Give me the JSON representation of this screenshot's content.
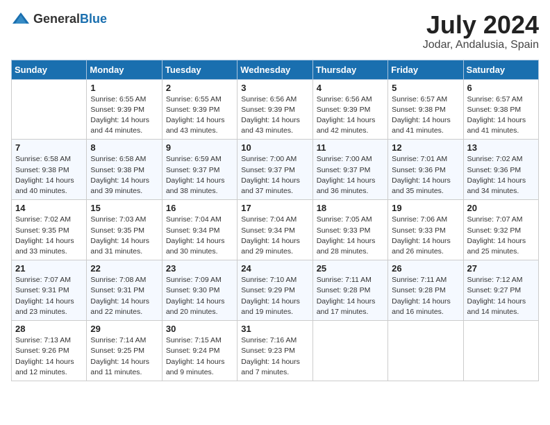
{
  "header": {
    "logo_general": "General",
    "logo_blue": "Blue",
    "month_year": "July 2024",
    "location": "Jodar, Andalusia, Spain"
  },
  "days_of_week": [
    "Sunday",
    "Monday",
    "Tuesday",
    "Wednesday",
    "Thursday",
    "Friday",
    "Saturday"
  ],
  "weeks": [
    [
      {
        "day": "",
        "info": ""
      },
      {
        "day": "1",
        "info": "Sunrise: 6:55 AM\nSunset: 9:39 PM\nDaylight: 14 hours\nand 44 minutes."
      },
      {
        "day": "2",
        "info": "Sunrise: 6:55 AM\nSunset: 9:39 PM\nDaylight: 14 hours\nand 43 minutes."
      },
      {
        "day": "3",
        "info": "Sunrise: 6:56 AM\nSunset: 9:39 PM\nDaylight: 14 hours\nand 43 minutes."
      },
      {
        "day": "4",
        "info": "Sunrise: 6:56 AM\nSunset: 9:39 PM\nDaylight: 14 hours\nand 42 minutes."
      },
      {
        "day": "5",
        "info": "Sunrise: 6:57 AM\nSunset: 9:38 PM\nDaylight: 14 hours\nand 41 minutes."
      },
      {
        "day": "6",
        "info": "Sunrise: 6:57 AM\nSunset: 9:38 PM\nDaylight: 14 hours\nand 41 minutes."
      }
    ],
    [
      {
        "day": "7",
        "info": "Sunrise: 6:58 AM\nSunset: 9:38 PM\nDaylight: 14 hours\nand 40 minutes."
      },
      {
        "day": "8",
        "info": "Sunrise: 6:58 AM\nSunset: 9:38 PM\nDaylight: 14 hours\nand 39 minutes."
      },
      {
        "day": "9",
        "info": "Sunrise: 6:59 AM\nSunset: 9:37 PM\nDaylight: 14 hours\nand 38 minutes."
      },
      {
        "day": "10",
        "info": "Sunrise: 7:00 AM\nSunset: 9:37 PM\nDaylight: 14 hours\nand 37 minutes."
      },
      {
        "day": "11",
        "info": "Sunrise: 7:00 AM\nSunset: 9:37 PM\nDaylight: 14 hours\nand 36 minutes."
      },
      {
        "day": "12",
        "info": "Sunrise: 7:01 AM\nSunset: 9:36 PM\nDaylight: 14 hours\nand 35 minutes."
      },
      {
        "day": "13",
        "info": "Sunrise: 7:02 AM\nSunset: 9:36 PM\nDaylight: 14 hours\nand 34 minutes."
      }
    ],
    [
      {
        "day": "14",
        "info": "Sunrise: 7:02 AM\nSunset: 9:35 PM\nDaylight: 14 hours\nand 33 minutes."
      },
      {
        "day": "15",
        "info": "Sunrise: 7:03 AM\nSunset: 9:35 PM\nDaylight: 14 hours\nand 31 minutes."
      },
      {
        "day": "16",
        "info": "Sunrise: 7:04 AM\nSunset: 9:34 PM\nDaylight: 14 hours\nand 30 minutes."
      },
      {
        "day": "17",
        "info": "Sunrise: 7:04 AM\nSunset: 9:34 PM\nDaylight: 14 hours\nand 29 minutes."
      },
      {
        "day": "18",
        "info": "Sunrise: 7:05 AM\nSunset: 9:33 PM\nDaylight: 14 hours\nand 28 minutes."
      },
      {
        "day": "19",
        "info": "Sunrise: 7:06 AM\nSunset: 9:33 PM\nDaylight: 14 hours\nand 26 minutes."
      },
      {
        "day": "20",
        "info": "Sunrise: 7:07 AM\nSunset: 9:32 PM\nDaylight: 14 hours\nand 25 minutes."
      }
    ],
    [
      {
        "day": "21",
        "info": "Sunrise: 7:07 AM\nSunset: 9:31 PM\nDaylight: 14 hours\nand 23 minutes."
      },
      {
        "day": "22",
        "info": "Sunrise: 7:08 AM\nSunset: 9:31 PM\nDaylight: 14 hours\nand 22 minutes."
      },
      {
        "day": "23",
        "info": "Sunrise: 7:09 AM\nSunset: 9:30 PM\nDaylight: 14 hours\nand 20 minutes."
      },
      {
        "day": "24",
        "info": "Sunrise: 7:10 AM\nSunset: 9:29 PM\nDaylight: 14 hours\nand 19 minutes."
      },
      {
        "day": "25",
        "info": "Sunrise: 7:11 AM\nSunset: 9:28 PM\nDaylight: 14 hours\nand 17 minutes."
      },
      {
        "day": "26",
        "info": "Sunrise: 7:11 AM\nSunset: 9:28 PM\nDaylight: 14 hours\nand 16 minutes."
      },
      {
        "day": "27",
        "info": "Sunrise: 7:12 AM\nSunset: 9:27 PM\nDaylight: 14 hours\nand 14 minutes."
      }
    ],
    [
      {
        "day": "28",
        "info": "Sunrise: 7:13 AM\nSunset: 9:26 PM\nDaylight: 14 hours\nand 12 minutes."
      },
      {
        "day": "29",
        "info": "Sunrise: 7:14 AM\nSunset: 9:25 PM\nDaylight: 14 hours\nand 11 minutes."
      },
      {
        "day": "30",
        "info": "Sunrise: 7:15 AM\nSunset: 9:24 PM\nDaylight: 14 hours\nand 9 minutes."
      },
      {
        "day": "31",
        "info": "Sunrise: 7:16 AM\nSunset: 9:23 PM\nDaylight: 14 hours\nand 7 minutes."
      },
      {
        "day": "",
        "info": ""
      },
      {
        "day": "",
        "info": ""
      },
      {
        "day": "",
        "info": ""
      }
    ]
  ]
}
